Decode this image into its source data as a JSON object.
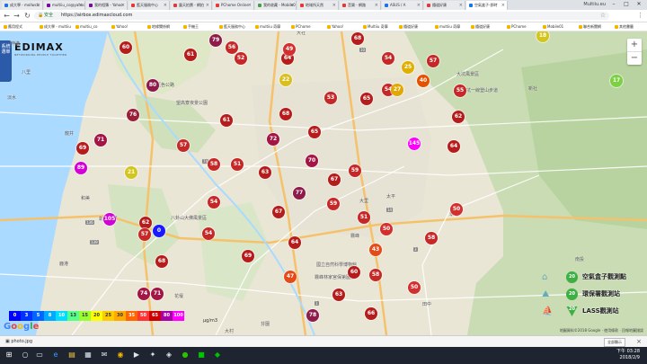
{
  "browser": {
    "tabs": [
      {
        "label": "成大學 - mollwcb",
        "color": "#1a73e8"
      },
      {
        "label": "multiiu_co@yahoo",
        "color": "#720e9e"
      },
      {
        "label": "我的相簿 - Yahoo",
        "color": "#720e9e"
      },
      {
        "label": "藍天服務中心",
        "color": "#e53935"
      },
      {
        "label": "露天拍賣 - 網拍",
        "color": "#e53935"
      },
      {
        "label": "PChome Online",
        "color": "#e53935"
      },
      {
        "label": "我的收藏 - Mobile01",
        "color": "#43a047"
      },
      {
        "label": "地域所天然",
        "color": "#e53935"
      },
      {
        "label": "音樂 - 網路",
        "color": "#e53935"
      },
      {
        "label": "ASUS / A",
        "color": "#1a73e8"
      },
      {
        "label": "鐵道好康",
        "color": "#e53935"
      },
      {
        "label": "空氣盒子-即時",
        "color": "#1a73e8"
      }
    ],
    "window_title": "Multiiu.eu",
    "secure_label": "安全",
    "url": "https://airbox.edimaxcloud.com",
    "bookmarks": [
      "應用程式",
      "成大學 - multiiu",
      "multiu_co",
      "Yahoo!",
      "地緣關係網",
      "手機王",
      "藍天服務中心",
      "multiiu 奇摩",
      "PChome",
      "Yahoo!",
      "Multiiu 奇摩",
      "鐵道好康",
      "multiiu 奇摩",
      "鐵道好康",
      "PChome",
      "Mobile01",
      "聯合新聞網",
      "其他書籤"
    ]
  },
  "map": {
    "logo_text": "EDIMAX",
    "logo_tagline": "NETWORKING PEOPLE TOGETHER",
    "side_tab": "系統選單",
    "zoom_in": "+",
    "zoom_out": "−",
    "places": [
      {
        "name": "大社"
      },
      {
        "name": "八里"
      },
      {
        "name": "淡水"
      },
      {
        "name": "大坑風景區"
      },
      {
        "name": "大坑一線登山步道"
      },
      {
        "name": "新社"
      },
      {
        "name": "望高寮夜景公園"
      },
      {
        "name": "大肚藍色公路"
      },
      {
        "name": "彰化"
      },
      {
        "name": "大里"
      },
      {
        "name": "霧峰"
      },
      {
        "name": "草屯"
      },
      {
        "name": "田中"
      },
      {
        "name": "霧峰林家宮保第園區"
      },
      {
        "name": "國立自然科學博物館"
      },
      {
        "name": "八卦山大佛風景區"
      },
      {
        "name": "花壇"
      },
      {
        "name": "芬園"
      },
      {
        "name": "南投"
      },
      {
        "name": "龍井"
      },
      {
        "name": "鹿港"
      },
      {
        "name": "和美"
      },
      {
        "name": "大村"
      },
      {
        "name": "伸港"
      },
      {
        "name": "太平"
      }
    ],
    "roads": [
      "10",
      "74",
      "136",
      "139",
      "139",
      "14",
      "3",
      "1"
    ],
    "legend_values": [
      "0",
      "3",
      "5",
      "8",
      "10",
      "13",
      "15",
      "20",
      "25",
      "30",
      "35",
      "50",
      "65",
      "80",
      "100"
    ],
    "legend_colors": [
      "#0000ff",
      "#0033ff",
      "#0066ff",
      "#00aaff",
      "#00ddff",
      "#55ff88",
      "#99ff33",
      "#ffff00",
      "#ffcc00",
      "#ffaa00",
      "#ff6600",
      "#ff3333",
      "#cc0000",
      "#aa00aa",
      "#ff00ff"
    ],
    "unit": "μg/m3",
    "google": "Google",
    "copyright": "地圖資料©2018 Google · 使用條款 · 回報地圖錯誤",
    "station_legend": [
      {
        "value": "20",
        "label": "空氣盒子觀測點"
      },
      {
        "value": "20",
        "label": "環保署觀測站"
      },
      {
        "value": "20",
        "label": "LASS觀測站"
      }
    ],
    "markers": [
      {
        "v": "60",
        "c": "#b71c1c"
      },
      {
        "v": "79",
        "c": "#8e1b4a"
      },
      {
        "v": "56",
        "c": "#c62828"
      },
      {
        "v": "61",
        "c": "#b71c1c"
      },
      {
        "v": "52",
        "c": "#c62828"
      },
      {
        "v": "64",
        "c": "#b71c1c"
      },
      {
        "v": "49",
        "c": "#d32f2f"
      },
      {
        "v": "68",
        "c": "#b71c1c"
      },
      {
        "v": "54",
        "c": "#c62828"
      },
      {
        "v": "18",
        "c": "#d4c51a"
      },
      {
        "v": "76",
        "c": "#9c1f3a"
      },
      {
        "v": "80",
        "c": "#8e1b4a"
      },
      {
        "v": "17",
        "c": "#7cd142"
      },
      {
        "v": "57",
        "c": "#c62828"
      },
      {
        "v": "54",
        "c": "#c62828"
      },
      {
        "v": "25",
        "c": "#e0b000"
      },
      {
        "v": "40",
        "c": "#e65100"
      },
      {
        "v": "62",
        "c": "#b71c1c"
      },
      {
        "v": "22",
        "c": "#d9c020"
      },
      {
        "v": "55",
        "c": "#c62828"
      },
      {
        "v": "27",
        "c": "#e0a800"
      },
      {
        "v": "65",
        "c": "#b71c1c"
      },
      {
        "v": "68",
        "c": "#b71c1c"
      },
      {
        "v": "53",
        "c": "#c62828"
      },
      {
        "v": "61",
        "c": "#b71c1c"
      },
      {
        "v": "71",
        "c": "#a31545"
      },
      {
        "v": "89",
        "c": "#d500d5"
      },
      {
        "v": "69",
        "c": "#b71c1c"
      },
      {
        "v": "57",
        "c": "#c62828"
      },
      {
        "v": "21",
        "c": "#d4c51a"
      },
      {
        "v": "145",
        "c": "#ff00ff"
      },
      {
        "v": "64",
        "c": "#b71c1c"
      },
      {
        "v": "59",
        "c": "#c62828"
      },
      {
        "v": "58",
        "c": "#c62828"
      },
      {
        "v": "63",
        "c": "#b71c1c"
      },
      {
        "v": "70",
        "c": "#a31545"
      },
      {
        "v": "77",
        "c": "#8e1b4a"
      },
      {
        "v": "51",
        "c": "#c62828"
      },
      {
        "v": "62",
        "c": "#b71c1c"
      },
      {
        "v": "54",
        "c": "#c62828"
      },
      {
        "v": "105",
        "c": "#d500d5"
      },
      {
        "v": "0",
        "c": "#1a1aff"
      },
      {
        "v": "57",
        "c": "#c62828"
      },
      {
        "v": "50",
        "c": "#d32f2f"
      },
      {
        "v": "67",
        "c": "#b71c1c"
      },
      {
        "v": "51",
        "c": "#c62828"
      },
      {
        "v": "59",
        "c": "#c62828"
      },
      {
        "v": "50",
        "c": "#d32f2f"
      },
      {
        "v": "68",
        "c": "#b71c1c"
      },
      {
        "v": "69",
        "c": "#b71c1c"
      },
      {
        "v": "64",
        "c": "#b71c1c"
      },
      {
        "v": "58",
        "c": "#c62828"
      },
      {
        "v": "43",
        "c": "#e64a19"
      },
      {
        "v": "47",
        "c": "#e64a19"
      },
      {
        "v": "60",
        "c": "#b71c1c"
      },
      {
        "v": "58",
        "c": "#c62828"
      },
      {
        "v": "74",
        "c": "#a31545"
      },
      {
        "v": "71",
        "c": "#a31545"
      },
      {
        "v": "63",
        "c": "#b71c1c"
      },
      {
        "v": "66",
        "c": "#b71c1c"
      },
      {
        "v": "78",
        "c": "#8e1b4a"
      },
      {
        "v": "50",
        "c": "#d32f2f"
      },
      {
        "v": "67",
        "c": "#b71c1c"
      },
      {
        "v": "72",
        "c": "#a31545"
      },
      {
        "v": "54",
        "c": "#c62828"
      },
      {
        "v": "65",
        "c": "#b71c1c"
      }
    ]
  },
  "downloads": {
    "file": "photo.jpg",
    "show_all": "全部顯示",
    "close": "×"
  },
  "taskbar": {
    "time": "下午 03:28",
    "date": "2018/2/9"
  }
}
